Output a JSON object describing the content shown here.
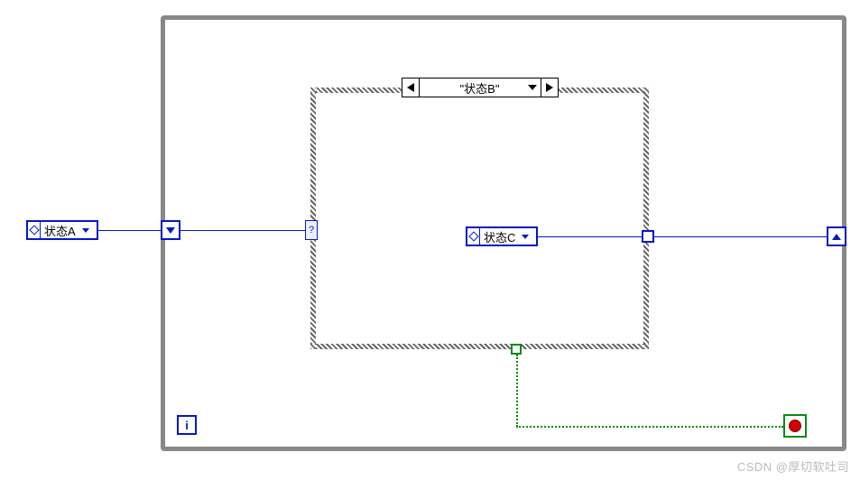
{
  "enumA": {
    "label": "状态A"
  },
  "enumC": {
    "label": "状态C"
  },
  "caseSelector": {
    "current": "\"状态B\""
  },
  "caseQuestion": "?",
  "iteration": {
    "symbol": "i"
  },
  "watermark": "CSDN @厚切软吐司"
}
